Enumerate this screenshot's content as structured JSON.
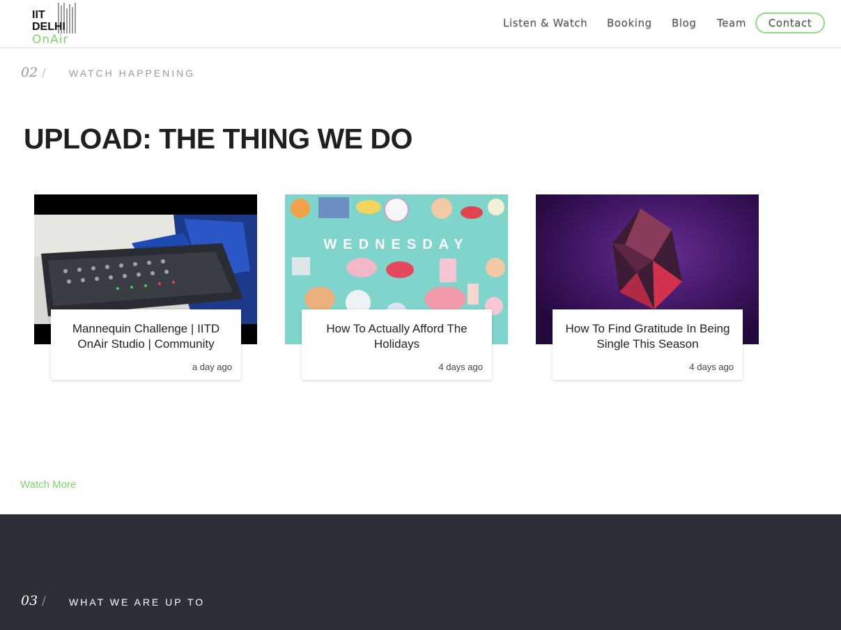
{
  "logo": {
    "line1": "IIT",
    "line2": "DELHI",
    "line3": "OnAir",
    "accent": "#7fd36e"
  },
  "nav": {
    "items": [
      "Listen & Watch",
      "Booking",
      "Blog",
      "Team"
    ],
    "contact": "Contact"
  },
  "section2": {
    "number": "02",
    "slash": "/",
    "label": "WATCH HAPPENING"
  },
  "title": "UPLOAD: THE THING WE DO",
  "videos": [
    {
      "title": "Mannequin Challenge | IITD OnAir Studio | Community",
      "time": "a day ago"
    },
    {
      "title": "How To Actually Afford The Holidays",
      "time": "4 days ago",
      "thumb_text": "WEDNESDAY"
    },
    {
      "title": "How To Find Gratitude In Being Single This Season",
      "time": "4 days ago"
    }
  ],
  "watch_more": "Watch More",
  "section3": {
    "number": "03",
    "slash": "/",
    "label": "WHAT WE ARE UP TO"
  },
  "colors": {
    "accent_green": "#7fd36e",
    "dark_bg": "#2c2f36"
  }
}
